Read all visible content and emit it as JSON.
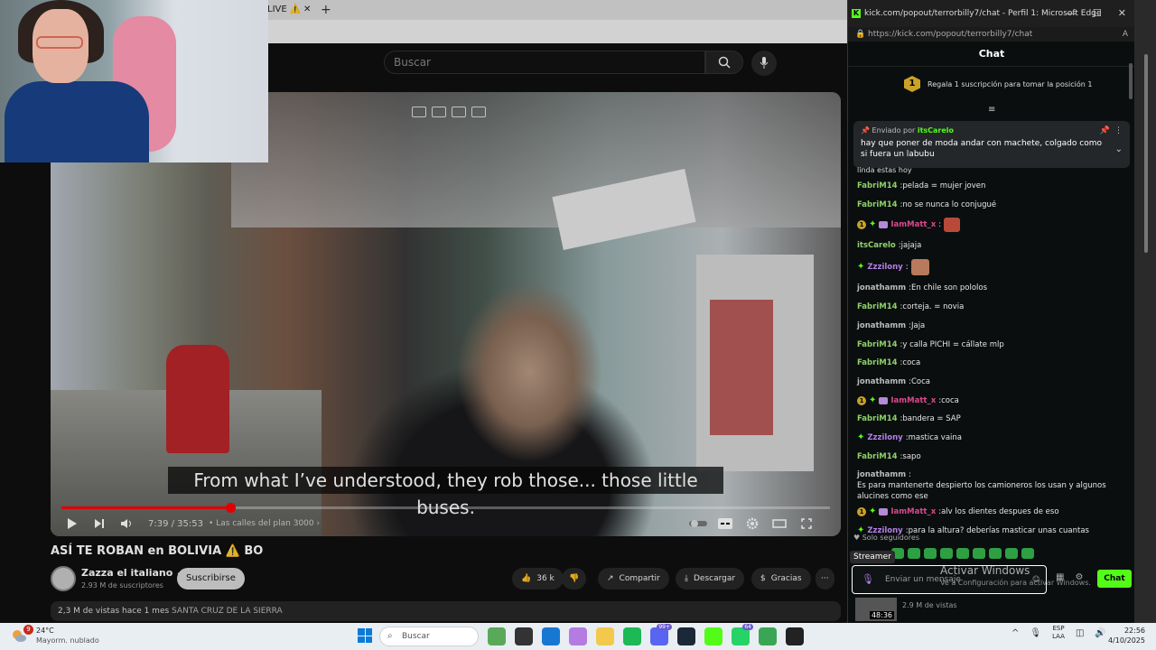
{
  "youtube": {
    "tab_label": "LIVE ⚠️",
    "search_placeholder": "Buscar",
    "subtitle": "From what I’ve understood, they rob those... those little buses.",
    "time": "7:39 / 35:53",
    "chapter": "• Las calles del plan 3000 ›",
    "progress": 0.22,
    "title": "ASÍ TE ROBAN en BOLIVIA ⚠️ BO",
    "channel": "Zazza el italiano ✓",
    "subscribers": "2.93 M de suscriptores",
    "subscribe_label": "Suscribirse",
    "likes": "36 k",
    "share_label": "Compartir",
    "download_label": "Descargar",
    "thanks_label": "Gracias",
    "more_label": "···",
    "meta_views": "2,3 M de vistas  hace 1 mes",
    "meta_location": "SANTA CRUZ DE LA SIERRA"
  },
  "kick": {
    "window_title": "kick.com/popout/terrorbilly7/chat - Perfil 1: Microsoft Edge",
    "url": "https://kick.com/popout/terrorbilly7/chat",
    "header": "Chat",
    "gift_badge": "1",
    "gift_text": "Regala 1 suscripción para tomar la posición 1",
    "pinned_by_prefix": "Enviado por",
    "pinned_user": "itsCarelo",
    "pinned_message": "hay que poner de moda andar con machete, colgado como si fuera un labubu",
    "partial_line": "linda estas hoy",
    "messages": [
      {
        "user": "FabriM14",
        "text": "pelada = mujer joven",
        "color": "#8fd16a",
        "badges": ""
      },
      {
        "user": "FabriM14",
        "text": "no se nunca lo conjugué",
        "color": "#8fd16a",
        "badges": ""
      },
      {
        "user": "IamMatt_x",
        "text": "",
        "color": "#d94a8c",
        "badges": "full",
        "emote": true
      },
      {
        "user": "itsCarelo",
        "text": "jajaja",
        "color": "#8fd16a",
        "badges": ""
      },
      {
        "user": "Zzzilony",
        "text": "",
        "color": "#b37fe8",
        "badges": "spark",
        "emote": true
      },
      {
        "user": "jonathamm",
        "text": "En chile son pololos",
        "color": "#bbbbbb",
        "badges": ""
      },
      {
        "user": "FabriM14",
        "text": "corteja. = novia",
        "color": "#8fd16a",
        "badges": ""
      },
      {
        "user": "jonathamm",
        "text": "Jaja",
        "color": "#bbbbbb",
        "badges": ""
      },
      {
        "user": "FabriM14",
        "text": "y calla PICHI = cállate mlp",
        "color": "#8fd16a",
        "badges": ""
      },
      {
        "user": "FabriM14",
        "text": "coca",
        "color": "#8fd16a",
        "badges": ""
      },
      {
        "user": "jonathamm",
        "text": "Coca",
        "color": "#bbbbbb",
        "badges": ""
      },
      {
        "user": "IamMatt_x",
        "text": "coca",
        "color": "#d94a8c",
        "badges": "full"
      },
      {
        "user": "FabriM14",
        "text": "bandera = SAP",
        "color": "#8fd16a",
        "badges": ""
      },
      {
        "user": "Zzzilony",
        "text": "mastica vaina",
        "color": "#b37fe8",
        "badges": "spark"
      },
      {
        "user": "FabriM14",
        "text": "sapo",
        "color": "#8fd16a",
        "badges": ""
      },
      {
        "user": "jonathamm",
        "text": "Es para mantenerte despierto los camioneros los usan y algunos alucines como ese",
        "color": "#bbbbbb",
        "badges": "",
        "wide": true
      },
      {
        "user": "IamMatt_x",
        "text": "alv los dientes despues de eso",
        "color": "#d94a8c",
        "badges": "full"
      },
      {
        "user": "Zzzilony",
        "text": "para la altura? deberías masticar unas cuantas",
        "color": "#b37fe8",
        "badges": "spark"
      }
    ],
    "solo_label": "♥ Solo seguidores",
    "streamer_label": "Streamer",
    "input_placeholder": "Enviar un mensaje",
    "chat_button": "Chat",
    "activate_title": "Activar Windows",
    "activate_sub": "Ve a Configuración para activar Windows.",
    "thumb_time": "48:36",
    "thumb_sub": "2.9 M de vistas"
  },
  "taskbar": {
    "weather_badge": "9",
    "temp": "24°C",
    "weather_desc": "Mayorm. nublado",
    "search_label": "Buscar",
    "lang1": "ESP",
    "lang2": "LAA",
    "time": "22:56",
    "date": "4/10/2025",
    "badge_a": "99+",
    "badge_b": "64"
  },
  "colors": {
    "kick_green": "#53fc18",
    "youtube_red": "#ff0000"
  }
}
